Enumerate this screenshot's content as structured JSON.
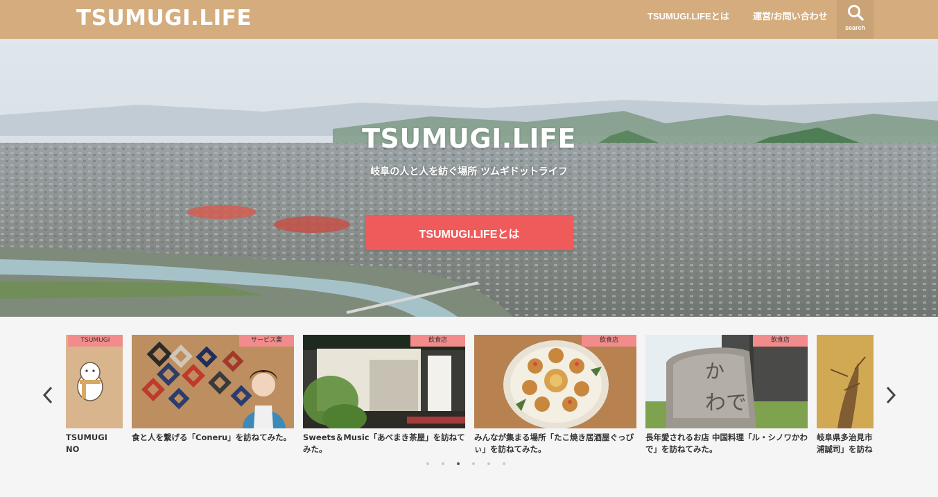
{
  "header": {
    "logo": "TSUMUGI.LIFE",
    "nav": [
      "TSUMUGI.LIFEとは",
      "運営/お問い合わせ"
    ],
    "search_label": "search"
  },
  "hero": {
    "title": "TSUMUGI.LIFE",
    "subtitle": "岐阜の人と人を紡ぐ場所 ツムギドットライフ",
    "button_label": "TSUMUGI.LIFEとは"
  },
  "carousel": {
    "cards": [
      {
        "category": "TSUMUGI",
        "title": "TSUMUGI NO"
      },
      {
        "category": "サービス業",
        "title": "食と人を繋げる「Coneru」を訪ねてみた。"
      },
      {
        "category": "飲食店",
        "title": "Sweets＆Music「あべまき茶屋」を訪ねてみた。"
      },
      {
        "category": "飲食店",
        "title": "みんなが集まる場所「たこ焼き居酒屋ぐっぴぃ」を訪ねてみた。"
      },
      {
        "category": "飲食店",
        "title": "長年愛されるお店 中国料理「ル・シノワかわで」を訪ねてみた。"
      },
      {
        "category": "",
        "title": "岐阜県多治見市浦誠司」を訪ね"
      }
    ],
    "dots_count": 6,
    "active_dot": 3
  },
  "colors": {
    "header_bg": "#d4ac7e",
    "accent_button": "#ef5a5a",
    "category_badge": "#f28b8b"
  }
}
